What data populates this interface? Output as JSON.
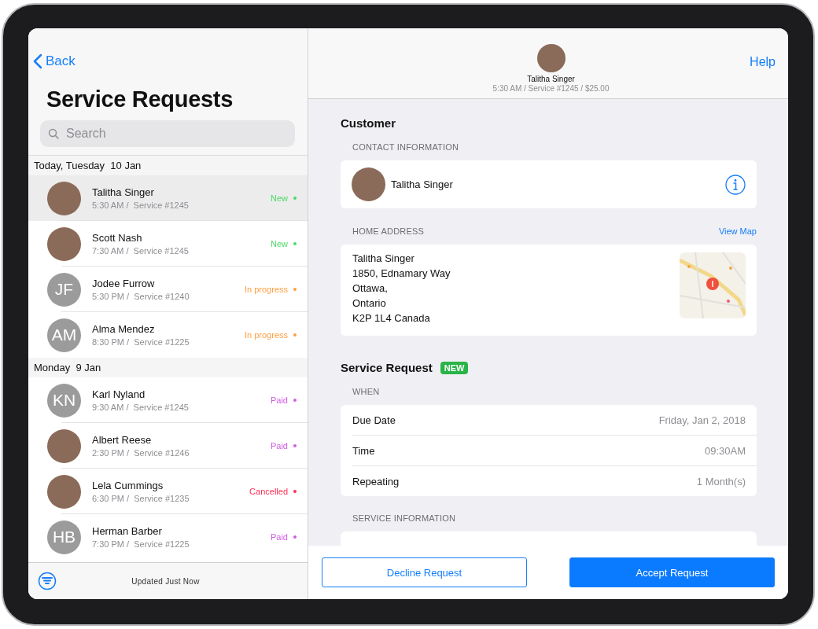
{
  "sidebar": {
    "back": "Back",
    "title": "Service Requests",
    "search": {
      "placeholder": "Search"
    },
    "sections": [
      {
        "header": "Today, Tuesday  10 Jan",
        "items": [
          {
            "kind": "photo",
            "name": "Talitha Singer",
            "detail": "5:30 AM /  Service #1245",
            "status": "New",
            "color": "#4cd964",
            "selected": true
          },
          {
            "kind": "photo",
            "name": "Scott Nash",
            "detail": "7:30 AM /  Service #1245",
            "status": "New",
            "color": "#4cd964",
            "selected": false
          },
          {
            "kind": "initials",
            "initials": "JF",
            "name": "Jodee Furrow",
            "detail": "5:30 PM /  Service #1240",
            "status": "In progress",
            "color": "#ff9f43",
            "selected": false
          },
          {
            "kind": "initials",
            "initials": "AM",
            "name": "Alma Mendez",
            "detail": "8:30 PM /  Service #1225",
            "status": "In progress",
            "color": "#ff9f43",
            "selected": false
          }
        ]
      },
      {
        "header": "Monday  9 Jan",
        "items": [
          {
            "kind": "initials",
            "initials": "KN",
            "name": "Karl Nyland",
            "detail": "9:30 AM /  Service #1245",
            "status": "Paid",
            "color": "#d05ce3",
            "selected": false
          },
          {
            "kind": "photo",
            "name": "Albert Reese",
            "detail": "2:30 PM /  Service #1246",
            "status": "Paid",
            "color": "#d05ce3",
            "selected": false
          },
          {
            "kind": "photo",
            "name": "Lela Cummings",
            "detail": "6:30 PM /  Service #1235",
            "status": "Cancelled",
            "color": "#ff2d55",
            "selected": false
          },
          {
            "kind": "initials",
            "initials": "HB",
            "name": "Herman Barber",
            "detail": "7:30 PM /  Service #1225",
            "status": "Paid",
            "color": "#d05ce3",
            "selected": false
          }
        ]
      }
    ],
    "footer": "Updated Just Now"
  },
  "detail": {
    "header": {
      "name": "Talitha Singer",
      "subtitle": "5:30 AM / Service #1245 / $25.00",
      "help": "Help"
    },
    "customer": {
      "title": "Customer",
      "contact_label": "CONTACT INFORMATION",
      "contact_name": "Talitha Singer",
      "address_label": "HOME ADDRESS",
      "view_map": "View Map",
      "address_lines": [
        "Talitha Singer",
        "1850, Ednamary Way",
        "Ottawa,",
        "Ontario",
        "K2P 1L4 Canada"
      ]
    },
    "request": {
      "title": "Service Request",
      "badge": "NEW",
      "when_label": "WHEN",
      "rows": [
        {
          "label": "Due Date",
          "value": "Friday, Jan 2, 2018"
        },
        {
          "label": "Time",
          "value": "09:30AM"
        },
        {
          "label": "Repeating",
          "value": "1 Month(s)"
        }
      ],
      "info_label": "SERVICE INFORMATION"
    },
    "buttons": {
      "decline": "Decline Request",
      "accept": "Accept Request"
    }
  }
}
